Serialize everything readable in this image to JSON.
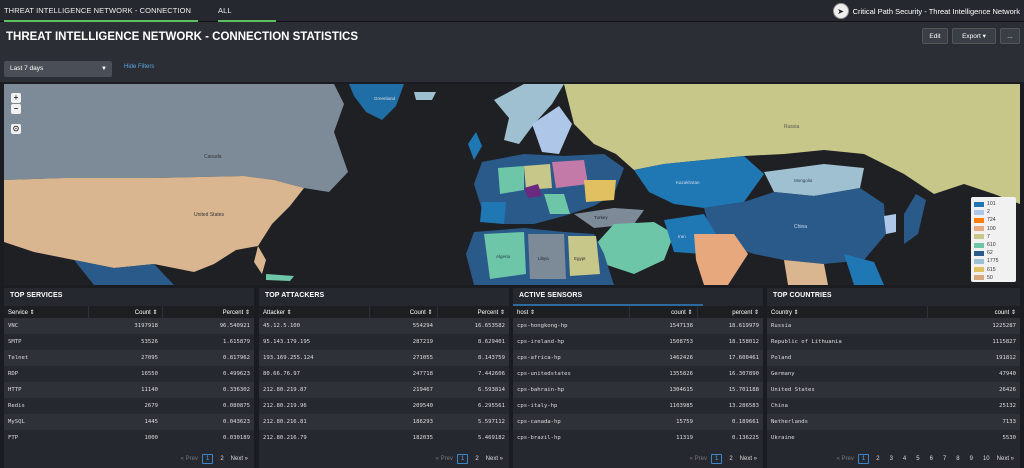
{
  "nav": {
    "tabs": [
      {
        "label": "THREAT INTELLIGENCE NETWORK - CONNECTION STATISTICS"
      },
      {
        "label": "ALL PROTOCOLS ▾"
      }
    ],
    "brand": "Critical Path Security - Threat Intelligence Network"
  },
  "header": {
    "title": "THREAT INTELLIGENCE NETWORK - CONNECTION STATISTICS",
    "edit_label": "Edit",
    "export_label": "Export ▾",
    "more_label": "..."
  },
  "filters": {
    "time_range": "Last 7 days",
    "hide_filters": "Hide Filters"
  },
  "map": {
    "zoom_in": "+",
    "zoom_out": "−",
    "locate": "⊙",
    "labels": {
      "canada": "Canada",
      "usa": "United States",
      "russia": "Russia",
      "kazakhstan": "Kazakhstan",
      "mongolia": "Mongolia",
      "china": "China",
      "algeria": "Algeria",
      "libya": "Libya",
      "egypt": "Egypt",
      "iran": "Iran",
      "turkey": "Turkey",
      "greenland": "Greenland"
    },
    "legend": [
      {
        "label": "101",
        "color": "#1f77b4"
      },
      {
        "label": "2",
        "color": "#aec7e8"
      },
      {
        "label": "724",
        "color": "#ff7f0e"
      },
      {
        "label": "100",
        "color": "#e6a87c"
      },
      {
        "label": "7",
        "color": "#c7c78a"
      },
      {
        "label": "610",
        "color": "#6ec6a8"
      },
      {
        "label": "62",
        "color": "#2a5a8a"
      },
      {
        "label": "1775",
        "color": "#9ec0d0"
      },
      {
        "label": "615",
        "color": "#e0c060"
      },
      {
        "label": "50",
        "color": "#d8a87c"
      }
    ]
  },
  "services": {
    "title": "TOP SERVICES",
    "columns": [
      "Service ⇕",
      "Count ⇕",
      "Percent ⇕"
    ],
    "rows": [
      [
        "VNC",
        "3197918",
        "96.540921"
      ],
      [
        "SMTP",
        "53526",
        "1.615879"
      ],
      [
        "Telnet",
        "27095",
        "0.817962"
      ],
      [
        "RDP",
        "16550",
        "0.499623"
      ],
      [
        "HTTP",
        "11140",
        "0.336302"
      ],
      [
        "Redis",
        "2679",
        "0.080875"
      ],
      [
        "MySQL",
        "1445",
        "0.043623"
      ],
      [
        "FTP",
        "1000",
        "0.030189"
      ]
    ],
    "pager": {
      "prev": "« Prev",
      "pages": [
        "1",
        "2"
      ],
      "next": "Next »"
    }
  },
  "attackers": {
    "title": "TOP ATTACKERS",
    "columns": [
      "Attacker ⇕",
      "Count ⇕",
      "Percent ⇕"
    ],
    "rows": [
      [
        "45.12.5.100",
        "554294",
        "16.653582"
      ],
      [
        "95.143.179.195",
        "287219",
        "8.629401"
      ],
      [
        "193.169.255.124",
        "271055",
        "8.143759"
      ],
      [
        "80.66.76.97",
        "247718",
        "7.442606"
      ],
      [
        "212.80.219.87",
        "219467",
        "6.593814"
      ],
      [
        "212.80.219.96",
        "209540",
        "6.295561"
      ],
      [
        "212.80.216.81",
        "186293",
        "5.597112"
      ],
      [
        "212.80.216.79",
        "182035",
        "5.469182"
      ]
    ],
    "pager": {
      "prev": "« Prev",
      "pages": [
        "1",
        "2"
      ],
      "next": "Next »"
    }
  },
  "sensors": {
    "title": "ACTIVE SENSORS",
    "columns": [
      "host ⇕",
      "count ⇕",
      "percent ⇕"
    ],
    "rows": [
      [
        "cps-hongkong-hp",
        "1547138",
        "18.619979"
      ],
      [
        "cps-ireland-hp",
        "1508753",
        "18.158012"
      ],
      [
        "cps-africa-hp",
        "1462426",
        "17.600461"
      ],
      [
        "cps-unitedstates",
        "1355826",
        "16.307890"
      ],
      [
        "cps-bahrain-hp",
        "1304615",
        "15.701188"
      ],
      [
        "cps-italy-hp",
        "1103985",
        "13.286583"
      ],
      [
        "cps-canada-hp",
        "15759",
        "0.189661"
      ],
      [
        "cps-brazil-hp",
        "11319",
        "0.136225"
      ]
    ],
    "pager": {
      "prev": "« Prev",
      "pages": [
        "1",
        "2"
      ],
      "next": "Next »"
    }
  },
  "countries": {
    "title": "TOP COUNTRIES",
    "columns": [
      "Country ⇕",
      "count ⇕"
    ],
    "rows": [
      [
        "Russia",
        "1225287"
      ],
      [
        "Republic of Lithuania",
        "1115827"
      ],
      [
        "Poland",
        "191812"
      ],
      [
        "Germany",
        "47940"
      ],
      [
        "United States",
        "26426"
      ],
      [
        "China",
        "25132"
      ],
      [
        "Netherlands",
        "7133"
      ],
      [
        "Ukraine",
        "5530"
      ]
    ],
    "pager": {
      "prev": "« Prev",
      "pages": [
        "1",
        "2",
        "3",
        "4",
        "5",
        "6",
        "7",
        "8",
        "9",
        "10"
      ],
      "next": "Next »"
    }
  }
}
